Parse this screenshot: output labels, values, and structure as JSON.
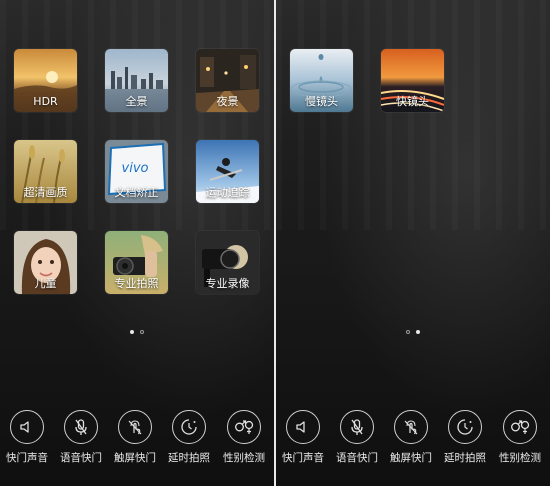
{
  "left_screen": {
    "modes": [
      {
        "id": "hdr",
        "label": "HDR"
      },
      {
        "id": "panorama",
        "label": "全景"
      },
      {
        "id": "night",
        "label": "夜景"
      },
      {
        "id": "super-hd",
        "label": "超清画质"
      },
      {
        "id": "document",
        "label": "文档矫正"
      },
      {
        "id": "motion",
        "label": "运动追踪"
      },
      {
        "id": "children",
        "label": "儿童"
      },
      {
        "id": "pro-photo",
        "label": "专业拍照"
      },
      {
        "id": "pro-video",
        "label": "专业录像"
      }
    ],
    "page_indicator": {
      "pages": 2,
      "current": 1
    }
  },
  "right_screen": {
    "modes": [
      {
        "id": "slow-motion",
        "label": "慢镜头"
      },
      {
        "id": "fast-motion",
        "label": "快镜头"
      }
    ],
    "page_indicator": {
      "pages": 2,
      "current": 2
    }
  },
  "document_tile_text": "vivo",
  "toolbar": {
    "shutter_sound": "快门声音",
    "voice_shutter": "语音快门",
    "touch_shutter": "触屏快门",
    "timer": "延时拍照",
    "gender_detect": "性别检测"
  },
  "icons": {
    "shutter_sound": "speaker-icon",
    "voice_shutter": "microphone-off-icon",
    "touch_shutter": "touch-off-icon",
    "timer": "timer-icon",
    "gender_detect": "gender-icon"
  },
  "colors": {
    "background": "#151515",
    "divider": "#e9e9e9",
    "icon_stroke": "#cfcfcf",
    "label_text": "#ececec"
  }
}
